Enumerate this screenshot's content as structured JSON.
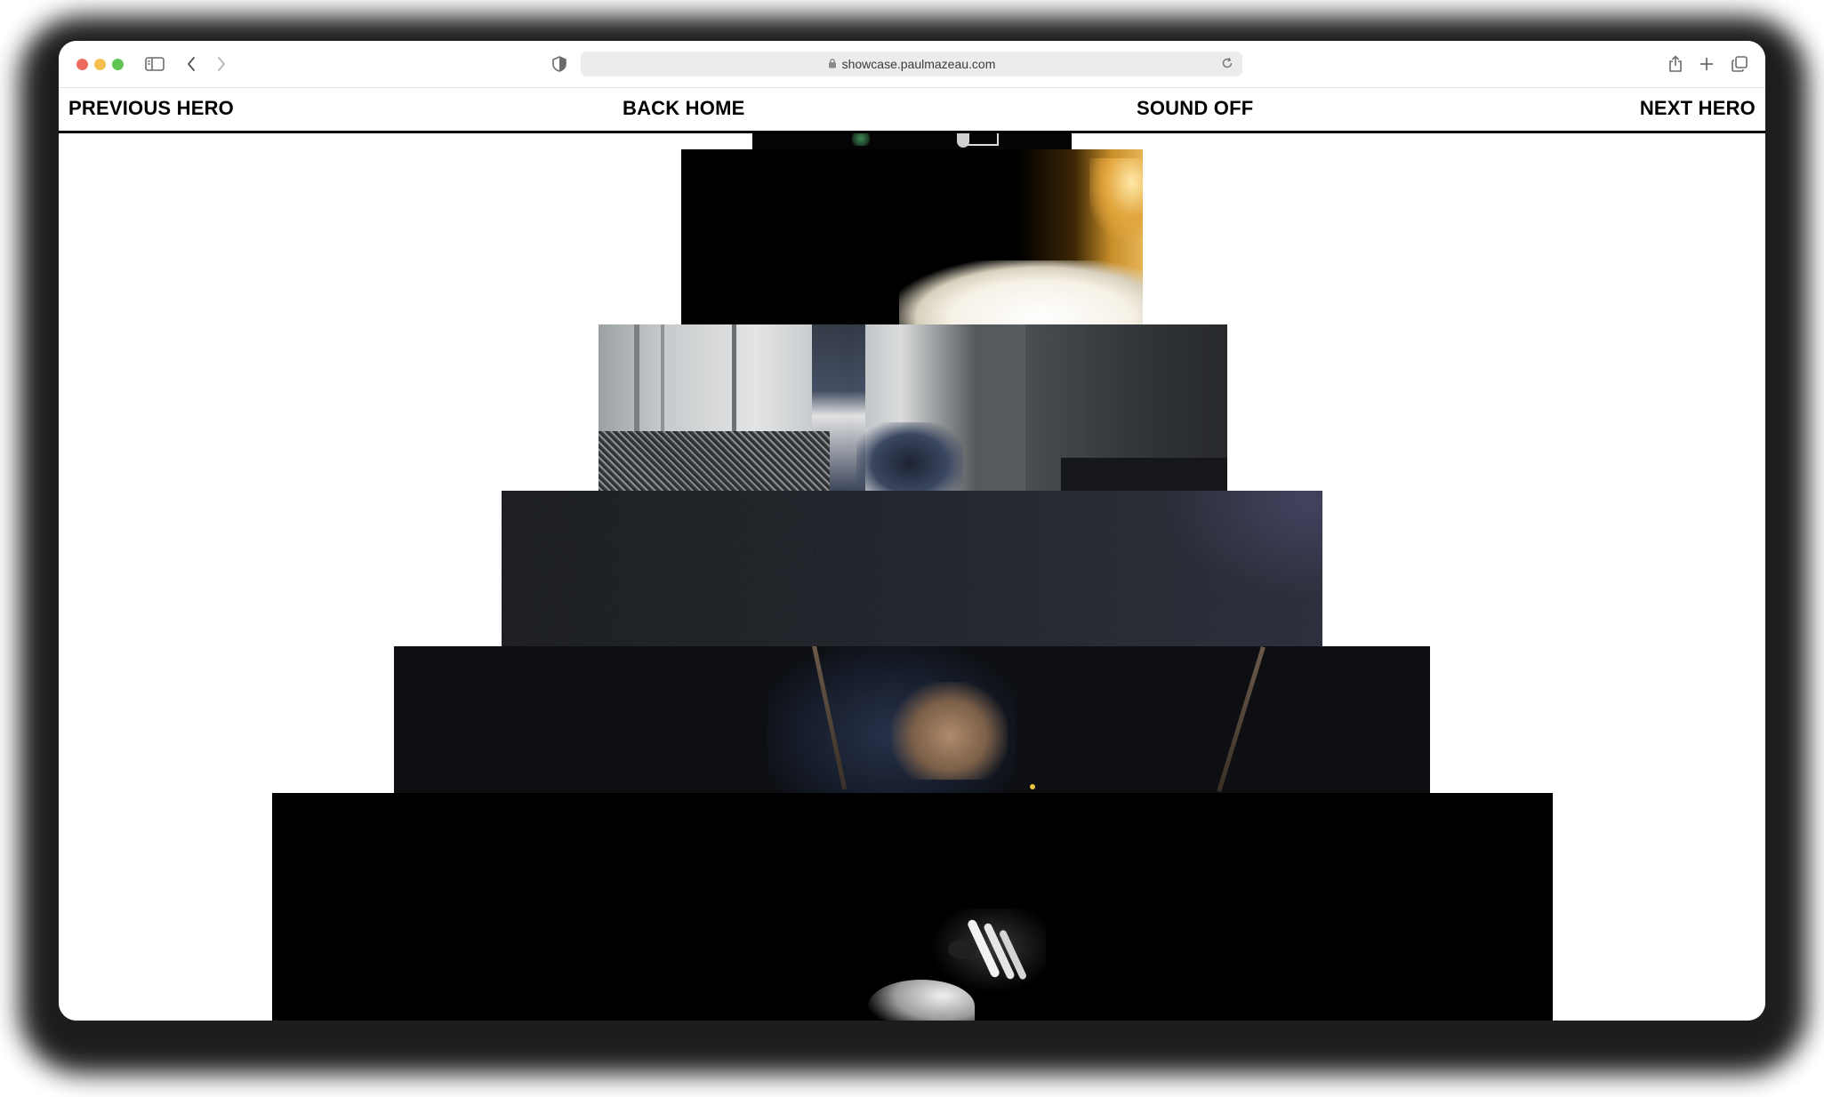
{
  "browser": {
    "url": "showcase.paulmazeau.com"
  },
  "nav": {
    "previous": "PREVIOUS HERO",
    "home": "BACK HOME",
    "sound": "SOUND OFF",
    "next": "NEXT HERO"
  },
  "colors": {
    "traffic_close": "#ed6a5e",
    "traffic_minimize": "#f5bf4f",
    "traffic_zoom": "#61c554",
    "nav_text": "#000000",
    "nav_rule": "#000000"
  },
  "icons": {
    "sidebar": "sidebar-icon",
    "back": "chevron-left-icon",
    "forward": "chevron-right-icon",
    "privacy": "shield-icon",
    "lock": "lock-icon",
    "reload": "reload-icon",
    "share": "share-icon",
    "new_tab": "plus-icon",
    "tabs": "tabs-overview-icon"
  }
}
